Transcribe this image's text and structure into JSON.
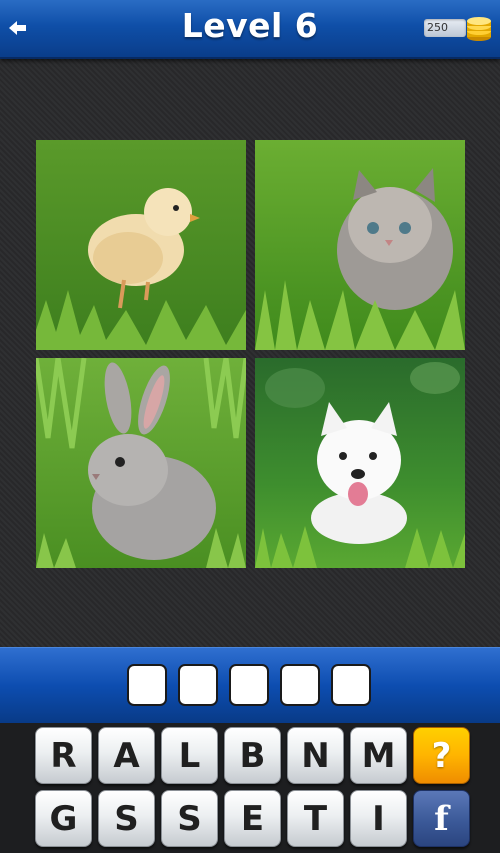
{
  "header": {
    "back_icon": "back-arrow-icon",
    "title": "Level 6",
    "coins": "250",
    "coin_icon": "coin-stack-icon"
  },
  "images": [
    {
      "subject": "chick-photo"
    },
    {
      "subject": "kitten-photo"
    },
    {
      "subject": "bunny-photo"
    },
    {
      "subject": "puppy-photo"
    }
  ],
  "answer": {
    "slots": [
      "",
      "",
      "",
      "",
      ""
    ]
  },
  "keyboard": {
    "row1": [
      "R",
      "A",
      "L",
      "B",
      "N",
      "M"
    ],
    "row2": [
      "G",
      "S",
      "S",
      "E",
      "T",
      "I"
    ],
    "hint_label": "?",
    "facebook_label": "f"
  },
  "colors": {
    "header_blue": "#0f4fa8",
    "hint_orange": "#ffb400",
    "facebook_blue": "#3b5998"
  }
}
